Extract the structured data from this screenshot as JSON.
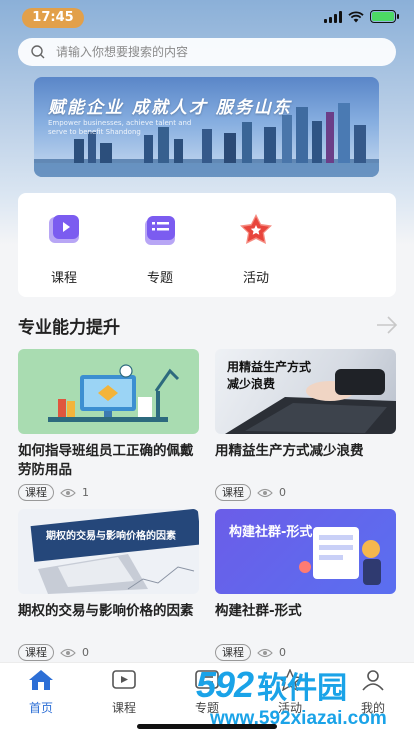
{
  "status_bar": {
    "time": "17:45"
  },
  "search": {
    "placeholder": "请输入你想要搜索的内容"
  },
  "banner": {
    "title": "赋能企业 成就人才 服务山东",
    "subtitle": "Empower businesses, achieve talent and serve to benefit Shandong"
  },
  "categories": [
    {
      "label": "课程",
      "icon": "video-icon"
    },
    {
      "label": "专题",
      "icon": "list-icon"
    },
    {
      "label": "活动",
      "icon": "star-icon"
    }
  ],
  "section": {
    "title": "专业能力提升"
  },
  "courses": [
    {
      "title": "如何指导班组员工正确的佩戴劳防用品",
      "tag": "课程",
      "views": "1",
      "thumb_text": ""
    },
    {
      "title": "用精益生产方式减少浪费",
      "tag": "课程",
      "views": "0",
      "thumb_text": "用精益生产方式\n减少浪费"
    },
    {
      "title": "期权的交易与影响价格的因素",
      "tag": "课程",
      "views": "0",
      "thumb_text": "期权的交易与影响价格的因素"
    },
    {
      "title": "构建社群-形式",
      "tag": "课程",
      "views": "0",
      "thumb_text": "构建社群-形式"
    }
  ],
  "tabs": [
    {
      "label": "首页",
      "active": true
    },
    {
      "label": "课程",
      "active": false
    },
    {
      "label": "专题",
      "active": false
    },
    {
      "label": "活动",
      "active": false
    },
    {
      "label": "我的",
      "active": false
    }
  ],
  "watermark": {
    "brand_num": "592",
    "brand_cn": "软件园",
    "url": "www.592xiazai.com"
  },
  "colors": {
    "accent": "#2d6fd6",
    "time_pill": "#e2a04a",
    "watermark": "#1aa3e8"
  }
}
